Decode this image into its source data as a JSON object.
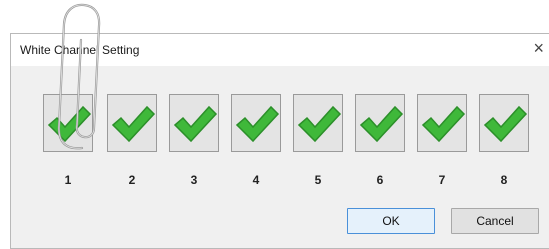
{
  "dialog": {
    "title": "White Channel Setting",
    "close_glyph": "×"
  },
  "channels": [
    {
      "label": "1",
      "checked": true
    },
    {
      "label": "2",
      "checked": true
    },
    {
      "label": "3",
      "checked": true
    },
    {
      "label": "4",
      "checked": true
    },
    {
      "label": "5",
      "checked": true
    },
    {
      "label": "6",
      "checked": true
    },
    {
      "label": "7",
      "checked": true
    },
    {
      "label": "8",
      "checked": true
    }
  ],
  "buttons": {
    "ok_label": "OK",
    "cancel_label": "Cancel"
  },
  "icons": {
    "check": "green-checkmark-icon",
    "clip": "paperclip-icon"
  },
  "colors": {
    "check_green": "#3fb83a",
    "check_dark": "#2c8f2a"
  }
}
